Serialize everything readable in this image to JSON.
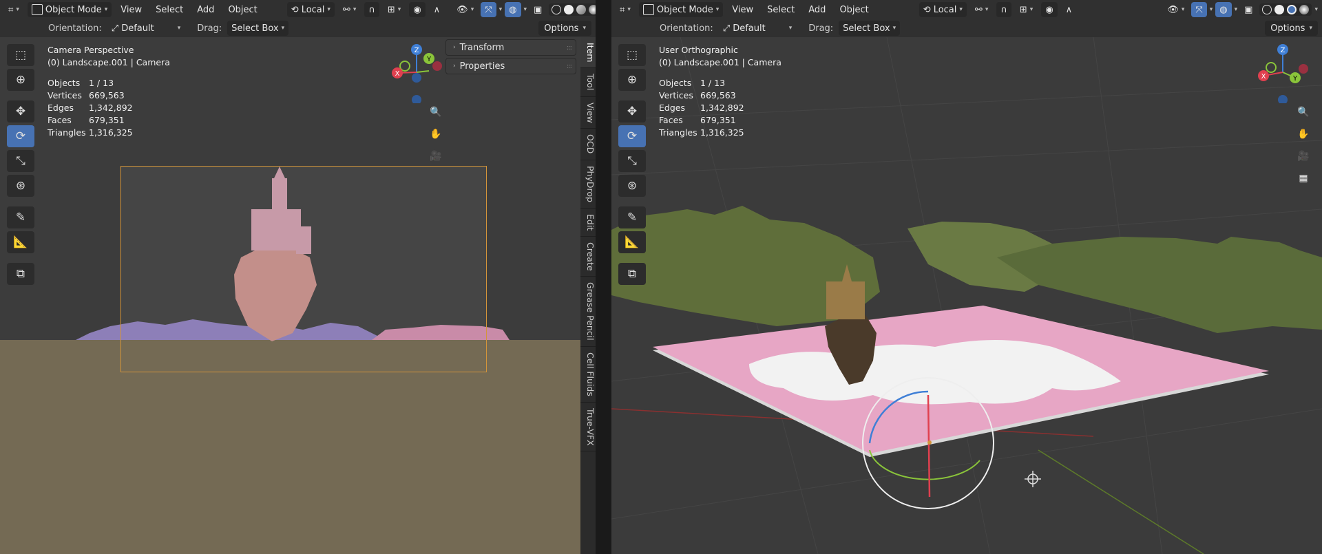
{
  "header": {
    "editor_type_icon": "view3d-icon",
    "mode": "Object Mode",
    "menus": [
      "View",
      "Select",
      "Add",
      "Object"
    ],
    "transform_orientation": "Local"
  },
  "subheader": {
    "orientation_label": "Orientation:",
    "orientation_value": "Default",
    "drag_label": "Drag:",
    "drag_value": "Select Box",
    "options": "Options"
  },
  "left_view": {
    "title": "Camera Perspective",
    "subtitle": "(0) Landscape.001 | Camera",
    "stats": [
      {
        "label": "Objects",
        "value": "1 / 13"
      },
      {
        "label": "Vertices",
        "value": "669,563"
      },
      {
        "label": "Edges",
        "value": "1,342,892"
      },
      {
        "label": "Faces",
        "value": "679,351"
      },
      {
        "label": "Triangles",
        "value": "1,316,325"
      }
    ]
  },
  "right_view": {
    "title": "User Orthographic",
    "subtitle": "(0) Landscape.001 | Camera",
    "stats": [
      {
        "label": "Objects",
        "value": "1 / 13"
      },
      {
        "label": "Vertices",
        "value": "669,563"
      },
      {
        "label": "Edges",
        "value": "1,342,892"
      },
      {
        "label": "Faces",
        "value": "679,351"
      },
      {
        "label": "Triangles",
        "value": "1,316,325"
      }
    ]
  },
  "sidebar": {
    "panels": [
      "Transform",
      "Properties"
    ],
    "tabs": [
      "Item",
      "Tool",
      "View",
      "OCD",
      "PhyDrop",
      "Edit",
      "Create",
      "Grease Pencil",
      "Cell Fluids",
      "True-VFX"
    ]
  },
  "gizmo_axes": {
    "x": "X",
    "y": "Y",
    "z": "Z"
  },
  "colors": {
    "accent": "#4772b3",
    "axis_x": "#e0404f",
    "axis_y": "#8ac43a",
    "axis_z": "#3f7fd6",
    "camera_frame": "#d4953a"
  }
}
